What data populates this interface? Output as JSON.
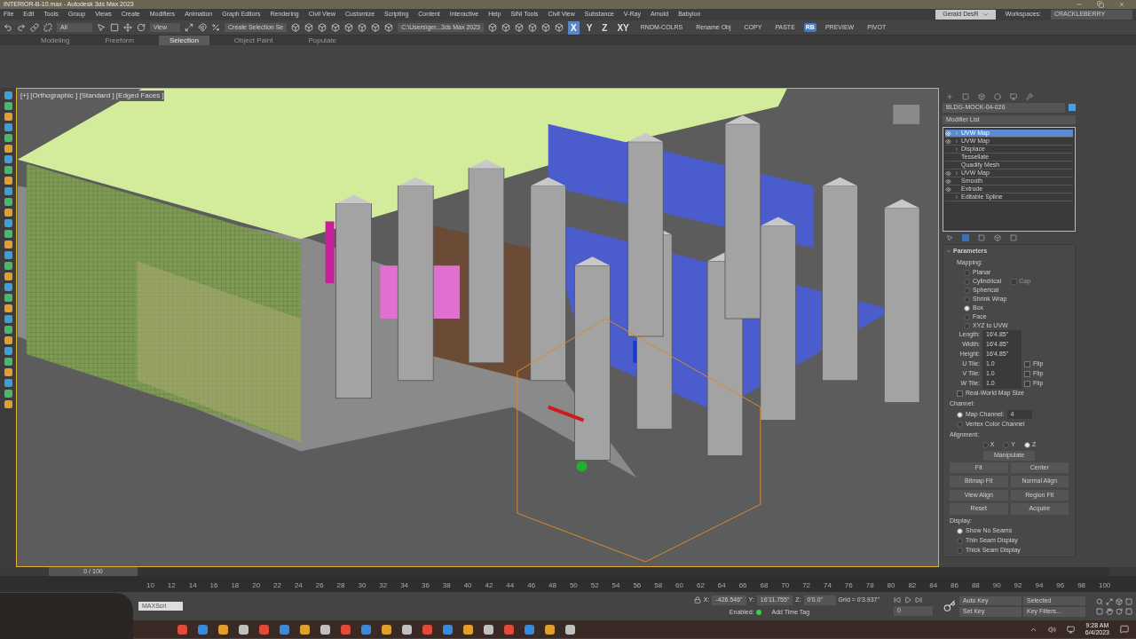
{
  "window": {
    "title": "INTERIOR-B-10.max - Autodesk 3ds Max 2023"
  },
  "menu": [
    "File",
    "Edit",
    "Tools",
    "Group",
    "Views",
    "Create",
    "Modifiers",
    "Animation",
    "Graph Editors",
    "Rendering",
    "Civil View",
    "Customize",
    "Scripting",
    "Content",
    "Interactive",
    "Help",
    "SiNi Tools",
    "Civil View",
    "Substance",
    "V-Ray",
    "Arnold",
    "Babylon"
  ],
  "account": {
    "user": "Gerald DesR",
    "workspaces_label": "Workspaces:",
    "workspace": "CRACKLEBERRY"
  },
  "toolbar": {
    "selection_filter": "All",
    "reference_coord": "View",
    "named_selection": "Create Selection Se",
    "project_path": "C:\\Users\\ger...3ds Max 2023",
    "axis_buttons": [
      {
        "label": "X",
        "selected": true
      },
      {
        "label": "Y",
        "selected": false
      },
      {
        "label": "Z",
        "selected": false
      },
      {
        "label": "XY",
        "selected": false
      }
    ],
    "script_buttons": [
      {
        "label": "RNDM-COLRS",
        "kind": "text"
      },
      {
        "label": "Rename Obj",
        "kind": "text"
      },
      {
        "label": "COPY",
        "kind": "text"
      },
      {
        "label": "PASTE",
        "kind": "text"
      },
      {
        "label": "RB",
        "kind": "badge"
      },
      {
        "label": "PREVIEW",
        "kind": "text"
      },
      {
        "label": "PIVOT",
        "kind": "text"
      }
    ]
  },
  "ribbon_tabs": [
    {
      "label": "Modeling",
      "selected": false
    },
    {
      "label": "Freeform",
      "selected": false
    },
    {
      "label": "Selection",
      "selected": true
    },
    {
      "label": "Object Paint",
      "selected": false
    },
    {
      "label": "Populate",
      "selected": false
    }
  ],
  "viewport": {
    "label": "[+] [Orthographic ] [Standard ] [Edged Faces ]"
  },
  "command_panel": {
    "object_name": "BLDG-MOCK-04-026",
    "modifier_list": "Modifier List",
    "stack": [
      {
        "label": "UVW Map",
        "eye": true,
        "expandable": true,
        "selected": true
      },
      {
        "label": "UVW Map",
        "eye": true,
        "expandable": true,
        "selected": false
      },
      {
        "label": "Displace",
        "eye": false,
        "expandable": true,
        "selected": false
      },
      {
        "label": "Tessellate",
        "eye": false,
        "expandable": false,
        "selected": false
      },
      {
        "label": "Quadify Mesh",
        "eye": false,
        "expandable": false,
        "selected": false
      },
      {
        "label": "UVW Map",
        "eye": true,
        "expandable": true,
        "selected": false
      },
      {
        "label": "Smooth",
        "eye": true,
        "expandable": false,
        "selected": false
      },
      {
        "label": "Extrude",
        "eye": true,
        "expandable": false,
        "selected": false
      },
      {
        "label": "Editable Spline",
        "eye": false,
        "expandable": true,
        "selected": false
      }
    ],
    "parameters": {
      "title": "Parameters",
      "mapping_label": "Mapping:",
      "mapping": [
        {
          "label": "Planar",
          "selected": false
        },
        {
          "label": "Cylindrical",
          "selected": false
        },
        {
          "label": "Spherical",
          "selected": false
        },
        {
          "label": "Shrink Wrap",
          "selected": false
        },
        {
          "label": "Box",
          "selected": true
        },
        {
          "label": "Face",
          "selected": false
        },
        {
          "label": "XYZ to UVW",
          "selected": false
        }
      ],
      "cap": {
        "label": "Cap",
        "checked": false,
        "disabled": true
      },
      "sizes": [
        {
          "label": "Length:",
          "value": "16'4.85\""
        },
        {
          "label": "Width:",
          "value": "16'4.85\""
        },
        {
          "label": "Height:",
          "value": "16'4.85\""
        }
      ],
      "tiles": [
        {
          "label": "U Tile:",
          "value": "1.0",
          "flip": "Flip",
          "flipped": false
        },
        {
          "label": "V Tile:",
          "value": "1.0",
          "flip": "Flip",
          "flipped": false
        },
        {
          "label": "W Tile:",
          "value": "1.0",
          "flip": "Flip",
          "flipped": false
        }
      ],
      "real_world": {
        "label": "Real-World Map Size",
        "checked": false
      },
      "channel_label": "Channel:",
      "channels": [
        {
          "label": "Map Channel:",
          "selected": true,
          "value": "4"
        },
        {
          "label": "Vertex Color Channel",
          "selected": false
        }
      ],
      "alignment_label": "Alignment:",
      "axes": [
        {
          "label": "X",
          "selected": false
        },
        {
          "label": "Y",
          "selected": false
        },
        {
          "label": "Z",
          "selected": true
        }
      ],
      "buttons": [
        "Manipulate",
        "Fit",
        "Center",
        "Bitmap Fit",
        "Normal Align",
        "View Align",
        "Region Fit",
        "Reset",
        "Acquire"
      ],
      "display_label": "Display:",
      "display": [
        {
          "label": "Show No Seams",
          "selected": true
        },
        {
          "label": "Thin Seam Display",
          "selected": false
        },
        {
          "label": "Thick Seam Display",
          "selected": false
        }
      ]
    }
  },
  "timeline": {
    "frame": "0 / 100",
    "level": 0,
    "ticks": [
      "10",
      "12",
      "14",
      "16",
      "18",
      "20",
      "22",
      "24",
      "26",
      "28",
      "30",
      "32",
      "34",
      "36",
      "38",
      "40",
      "42",
      "44",
      "46",
      "48",
      "50",
      "52",
      "54",
      "56",
      "58",
      "60",
      "62",
      "64",
      "66",
      "68",
      "70",
      "72",
      "74",
      "76",
      "78",
      "80",
      "82",
      "84",
      "86",
      "88",
      "90",
      "92",
      "94",
      "96",
      "98",
      "100"
    ]
  },
  "status": {
    "maxscript": "MAXScri",
    "x_label": "X:",
    "x": "-426.546\"",
    "y_label": "Y:",
    "y": "16'11.755\"",
    "z_label": "Z:",
    "z": "0'0.0\"",
    "grid": "Grid = 0'3.937\"",
    "enabled_label": "Enabled:",
    "add_time_tag": "Add Time Tag",
    "current_frame": "0",
    "auto_key": "Auto Key",
    "set_key": "Set Key",
    "key_mode": "Selected",
    "key_filters": "Key Filters..."
  },
  "taskbar": {
    "time": "9:28 AM",
    "date": "6/4/2023"
  }
}
